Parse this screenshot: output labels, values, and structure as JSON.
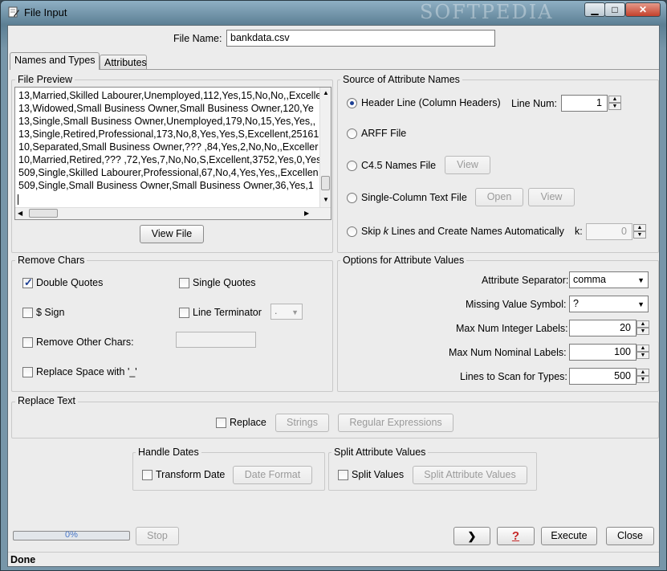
{
  "window": {
    "title": "File Input",
    "watermark": "SOFTPEDIA"
  },
  "file_name": {
    "label": "File Name:",
    "value": "bankdata.csv"
  },
  "tabs": [
    {
      "label": "Names and Types",
      "active": true
    },
    {
      "label": "Attributes",
      "active": false
    }
  ],
  "file_preview": {
    "title": "File Preview",
    "lines": [
      "13,Married,Skilled Labourer,Unemployed,112,Yes,15,No,No,,Excelle",
      "13,Widowed,Small Business Owner,Small Business Owner,120,Ye",
      "13,Single,Small Business Owner,Unemployed,179,No,15,Yes,Yes,,",
      "13,Single,Retired,Professional,173,No,8,Yes,Yes,S,Excellent,25161",
      "10,Separated,Small Business Owner,???  ,84,Yes,2,No,No,,Exceller",
      "10,Married,Retired,???  ,72,Yes,7,No,No,S,Excellent,3752,Yes,0,Yes",
      "509,Single,Skilled Labourer,Professional,67,No,4,Yes,Yes,,Excellen",
      "509,Single,Small Business Owner,Small Business Owner,36,Yes,1"
    ],
    "view_button": "View File"
  },
  "source": {
    "title": "Source of Attribute Names",
    "header_line": "Header Line (Column Headers)",
    "line_num_label": "Line Num:",
    "line_num_value": "1",
    "arff": "ARFF File",
    "c45": "C4.5 Names File",
    "c45_view": "View",
    "single_column": "Single-Column Text File",
    "open": "Open",
    "single_view": "View",
    "skip_prefix": "Skip ",
    "skip_k": "k",
    "skip_suffix": " Lines and Create Names Automatically",
    "k_label": "k:",
    "k_value": "0"
  },
  "remove_chars": {
    "title": "Remove Chars",
    "double_quotes": "Double Quotes",
    "single_quotes": "Single Quotes",
    "dollar_sign": "$ Sign",
    "line_terminator": "Line Terminator",
    "line_terminator_value": ".",
    "remove_other": "Remove Other Chars:",
    "replace_space": "Replace Space with '_'"
  },
  "options": {
    "title": "Options for Attribute Values",
    "separator_label": "Attribute Separator:",
    "separator_value": "comma",
    "missing_label": "Missing Value Symbol:",
    "missing_value": "?",
    "max_int_label": "Max Num Integer Labels:",
    "max_int_value": "20",
    "max_nominal_label": "Max Num Nominal Labels:",
    "max_nominal_value": "100",
    "lines_scan_label": "Lines to Scan for Types:",
    "lines_scan_value": "500"
  },
  "replace_text": {
    "title": "Replace Text",
    "replace": "Replace",
    "strings": "Strings",
    "regex": "Regular Expressions"
  },
  "handle_dates": {
    "title": "Handle Dates",
    "transform": "Transform Date",
    "format": "Date Format"
  },
  "split": {
    "title": "Split Attribute Values",
    "split_values": "Split Values",
    "split_button": "Split Attribute Values"
  },
  "bottom": {
    "progress": "0%",
    "stop": "Stop",
    "next_icon": "❯",
    "help_icon": "?",
    "execute": "Execute",
    "close": "Close"
  },
  "status": "Done"
}
